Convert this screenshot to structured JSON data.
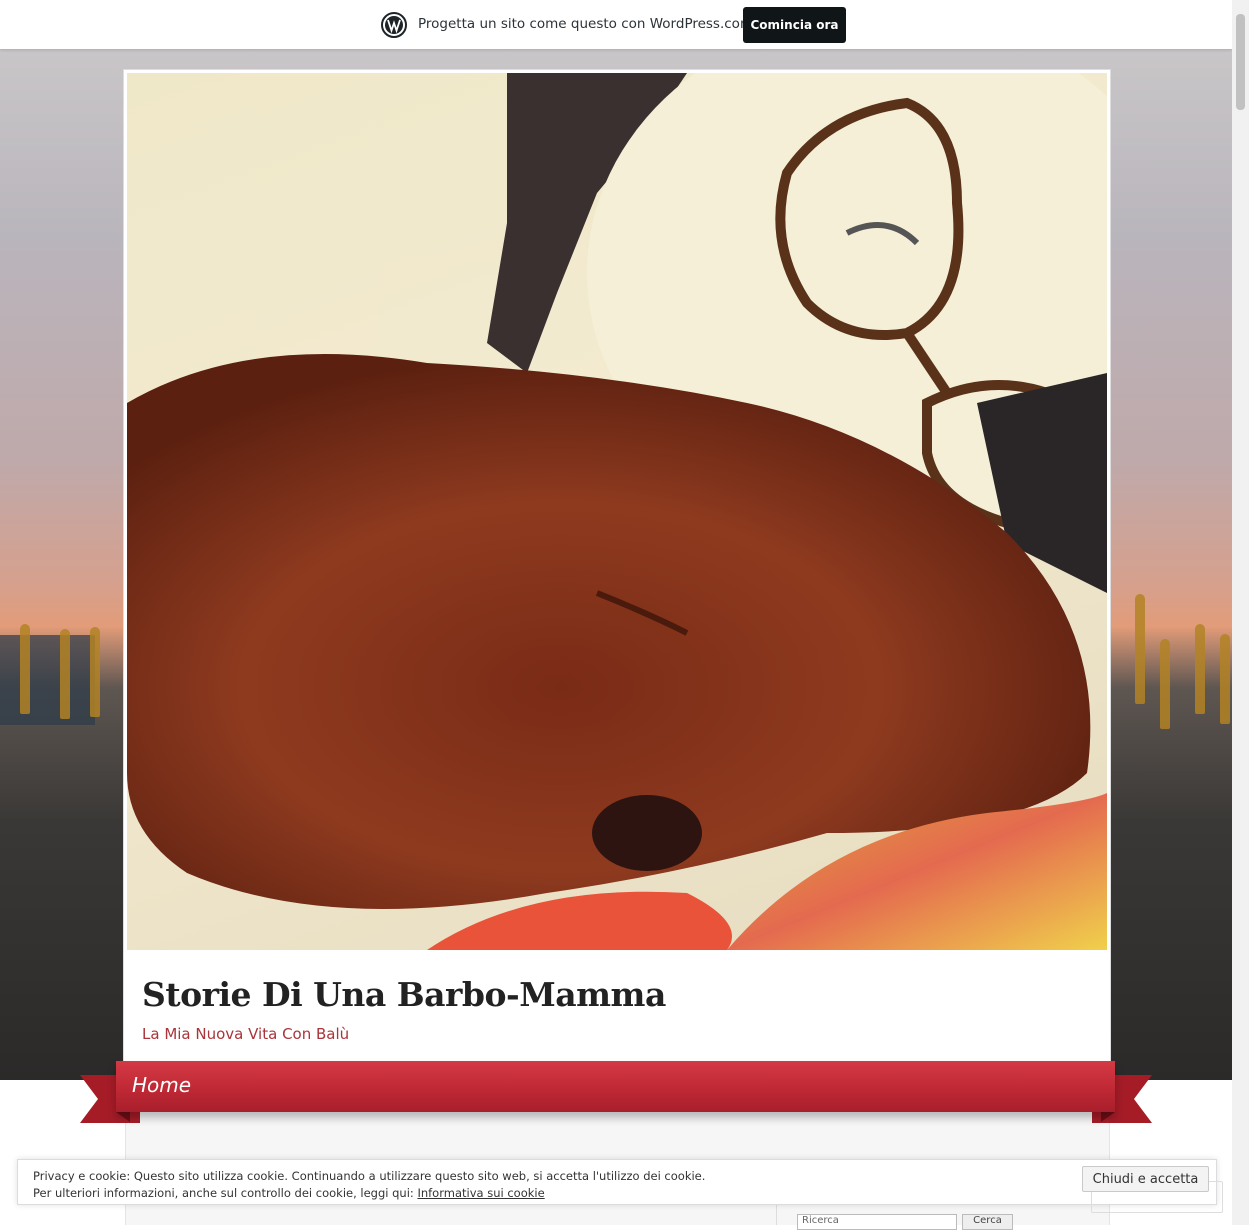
{
  "wp_banner": {
    "text": "Progetta un sito come questo con WordPress.com",
    "button": "Comincia ora",
    "logo_icon": "wordpress-logo-icon"
  },
  "hero": {
    "description_icon": "hero-photo-icon"
  },
  "site": {
    "title": "Storie Di Una Barbo-Mamma",
    "tagline": "La Mia Nuova Vita Con Balù"
  },
  "nav": {
    "items": [
      {
        "label": "Home"
      }
    ]
  },
  "sidebar": {
    "search_placeholder": "Ricerca",
    "search_button": "Cerca"
  },
  "cookie": {
    "line1": "Privacy e cookie: Questo sito utilizza cookie. Continuando a utilizzare questo sito web, si accetta l'utilizzo dei cookie.",
    "line2_prefix": "Per ulteriori informazioni, anche sul controllo dei cookie, leggi qui:",
    "link": "Informativa sui cookie",
    "accept": "Chiudi e accetta"
  },
  "colors": {
    "accent": "#c12a36",
    "tagline": "#a9343a",
    "wp_button": "#101517"
  }
}
